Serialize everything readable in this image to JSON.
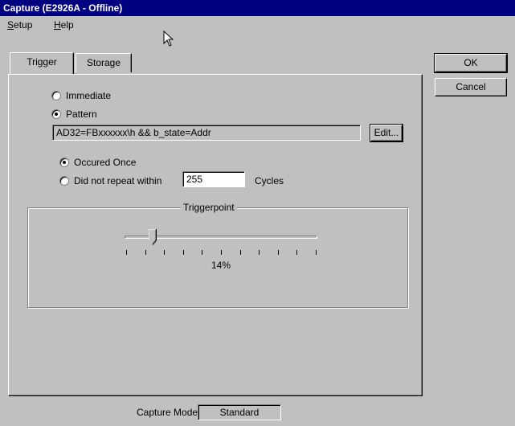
{
  "window": {
    "title": "Capture (E2926A - Offline)"
  },
  "menu": {
    "setup": "Setup",
    "setup_key": "S",
    "setup_rest": "etup",
    "help": "Help",
    "help_key": "H",
    "help_rest": "elp"
  },
  "tabs": [
    {
      "label": "Trigger",
      "active": true
    },
    {
      "label": "Storage",
      "active": false
    }
  ],
  "trigger": {
    "immediate_label": "Immediate",
    "pattern_label": "Pattern",
    "selected_mode": "Pattern",
    "pattern_value": "AD32=FBxxxxxx\\h && b_state=Addr",
    "edit_label": "Edit...",
    "occured_once_label": "Occured Once",
    "did_not_repeat_label": "Did not repeat within",
    "repeat_value": "255",
    "cycles_label": "Cycles",
    "selected_occurrence": "Occured Once",
    "triggerpoint_label": "Triggerpoint",
    "triggerpoint_percent": 14,
    "triggerpoint_text": "14%"
  },
  "buttons": {
    "ok": "OK",
    "cancel": "Cancel"
  },
  "status": {
    "capture_mode_label": "Capture Mode:",
    "capture_mode_value": "Standard"
  }
}
